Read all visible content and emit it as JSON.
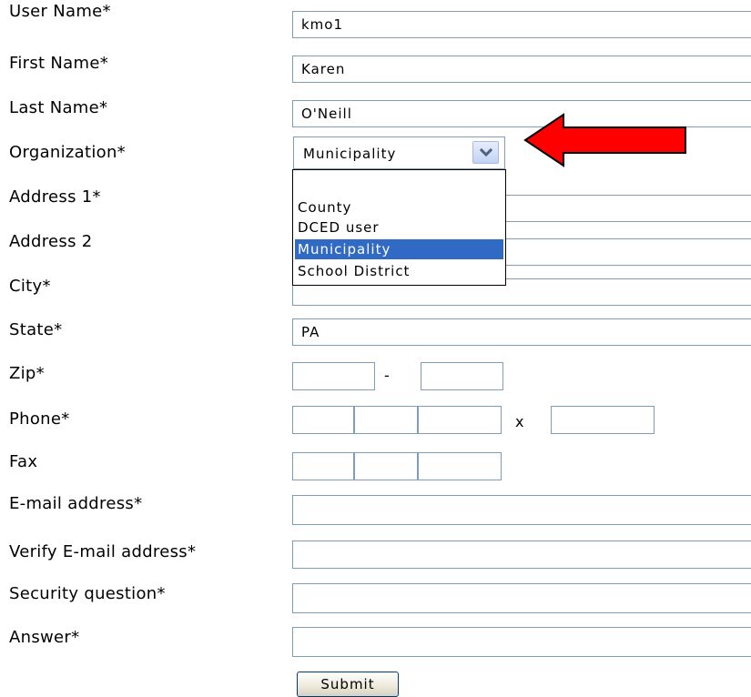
{
  "form": {
    "labels": {
      "user_name": "User Name*",
      "first_name": "First Name*",
      "last_name": "Last Name*",
      "organization": "Organization*",
      "address1": "Address 1*",
      "address2": "Address 2",
      "city": "City*",
      "state": "State*",
      "zip": "Zip*",
      "phone": "Phone*",
      "fax": "Fax",
      "email": "E-mail address*",
      "verify_email": "Verify E-mail address*",
      "security_question": "Security question*",
      "answer": "Answer*"
    },
    "values": {
      "user_name": "kmo1",
      "first_name": "Karen",
      "last_name": "O'Neill",
      "state": "PA"
    },
    "organization": {
      "selected": "Municipality",
      "options": [
        "",
        "County",
        "DCED user",
        "Municipality",
        "School District"
      ]
    },
    "separators": {
      "zip_dash": "-",
      "phone_ext": "x"
    },
    "submit_label": "Submit"
  },
  "colors": {
    "field_border": "#7f9db9",
    "selected_option_bg": "#316ac5",
    "arrow_fill": "#ff0000"
  },
  "annotations": {
    "pointer": "red-arrow-icon"
  }
}
